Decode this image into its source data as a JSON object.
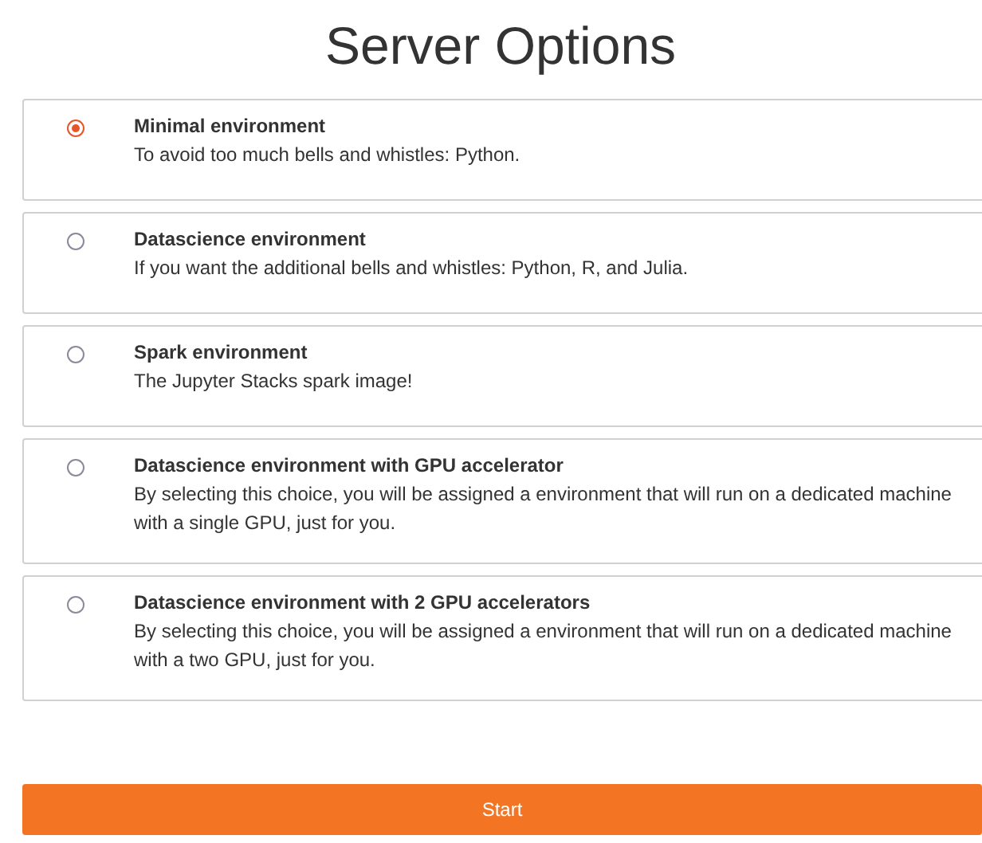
{
  "title": "Server Options",
  "options": [
    {
      "name": "Minimal environment",
      "description": "To avoid too much bells and whistles: Python.",
      "selected": true
    },
    {
      "name": "Datascience environment",
      "description": "If you want the additional bells and whistles: Python, R, and Julia.",
      "selected": false
    },
    {
      "name": "Spark environment",
      "description": "The Jupyter Stacks spark image!",
      "selected": false
    },
    {
      "name": "Datascience environment with GPU accelerator",
      "description": "By selecting this choice, you will be assigned a environment that will run on a dedicated machine with a single GPU, just for you.",
      "selected": false
    },
    {
      "name": "Datascience environment with 2 GPU accelerators",
      "description": "By selecting this choice, you will be assigned a environment that will run on a dedicated machine with a two GPU, just for you.",
      "selected": false
    }
  ],
  "start_button": "Start"
}
